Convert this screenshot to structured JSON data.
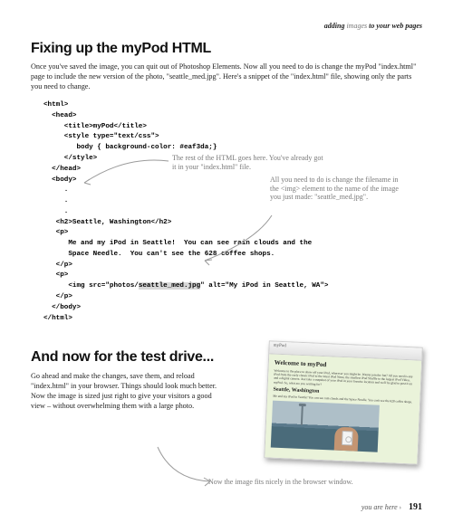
{
  "header": {
    "prefix": "adding",
    "em": "images",
    "suffix": "to your web pages"
  },
  "section1": {
    "title": "Fixing up the myPod HTML",
    "intro": "Once you've saved the image, you can quit out of Photoshop Elements. Now all you need to do is change the myPod \"index.html\" page to include the new version of the photo, \"seattle_med.jpg\". Here's a snippet of the \"index.html\" file, showing only the parts you need to change.",
    "code": {
      "l1": "<html>",
      "l2": "  <head>",
      "l3": "     <title>myPod</title>",
      "l4": "     <style type=\"text/css\">",
      "l5": "        body { background-color: #eaf3da;}",
      "l6": "     </style>",
      "l7": "  </head>",
      "l8": "  <body>",
      "l9": "     .",
      "l10": "     .",
      "l11": "     .",
      "l12": "   <h2>Seattle, Washington</h2>",
      "l13": "   <p>",
      "l14": "      Me and my iPod in Seattle!  You can see rain clouds and the",
      "l15": "      Space Needle.  You can't see the 628 coffee shops.",
      "l16": "   </p>",
      "l17": "   <p>",
      "l18a": "      <img src=\"photos/",
      "l18h": "seattle_med.jpg",
      "l18b": "\" alt=\"My iPod in Seattle, WA\">",
      "l19": "   </p>",
      "l20": "  </body>",
      "l21": "</html>"
    },
    "annotation1": "The rest of the HTML goes here. You've already got it in your \"index.html\" file.",
    "annotation2": "All you need to do is change the filename in the <img> element to the name of the image you just made: \"seattle_med.jpg\"."
  },
  "section2": {
    "title": "And now for the test drive...",
    "intro": "Go ahead and make the changes, save them, and reload \"index.html\" in your browser. Things should look much better. Now the image is sized just right to give your visitors a good view – without overwhelming them with a large photo.",
    "annotation3": "Now the image fits nicely in the browser window."
  },
  "browser": {
    "title": "Welcome to myPod",
    "p1": "Welcome to the place to show off your iPod, wherever you might be. Wanna join the fun? All you need is any iPod from the early classic iPod to the latest iPod Nano, the smallest iPod Shuffle to the largest iPod Video, and a digital camera. Just take a snapshot of your iPod in your favorite location and we'll be glad to post it on myPod. So, what are you waiting for?",
    "h2": "Seattle, Washington",
    "p2": "Me and my iPod in Seattle! You can see rain clouds and the Space Needle. You can't see the 628 coffee shops."
  },
  "footer": {
    "yah": "you are here",
    "arrow": "›",
    "page": "191"
  }
}
